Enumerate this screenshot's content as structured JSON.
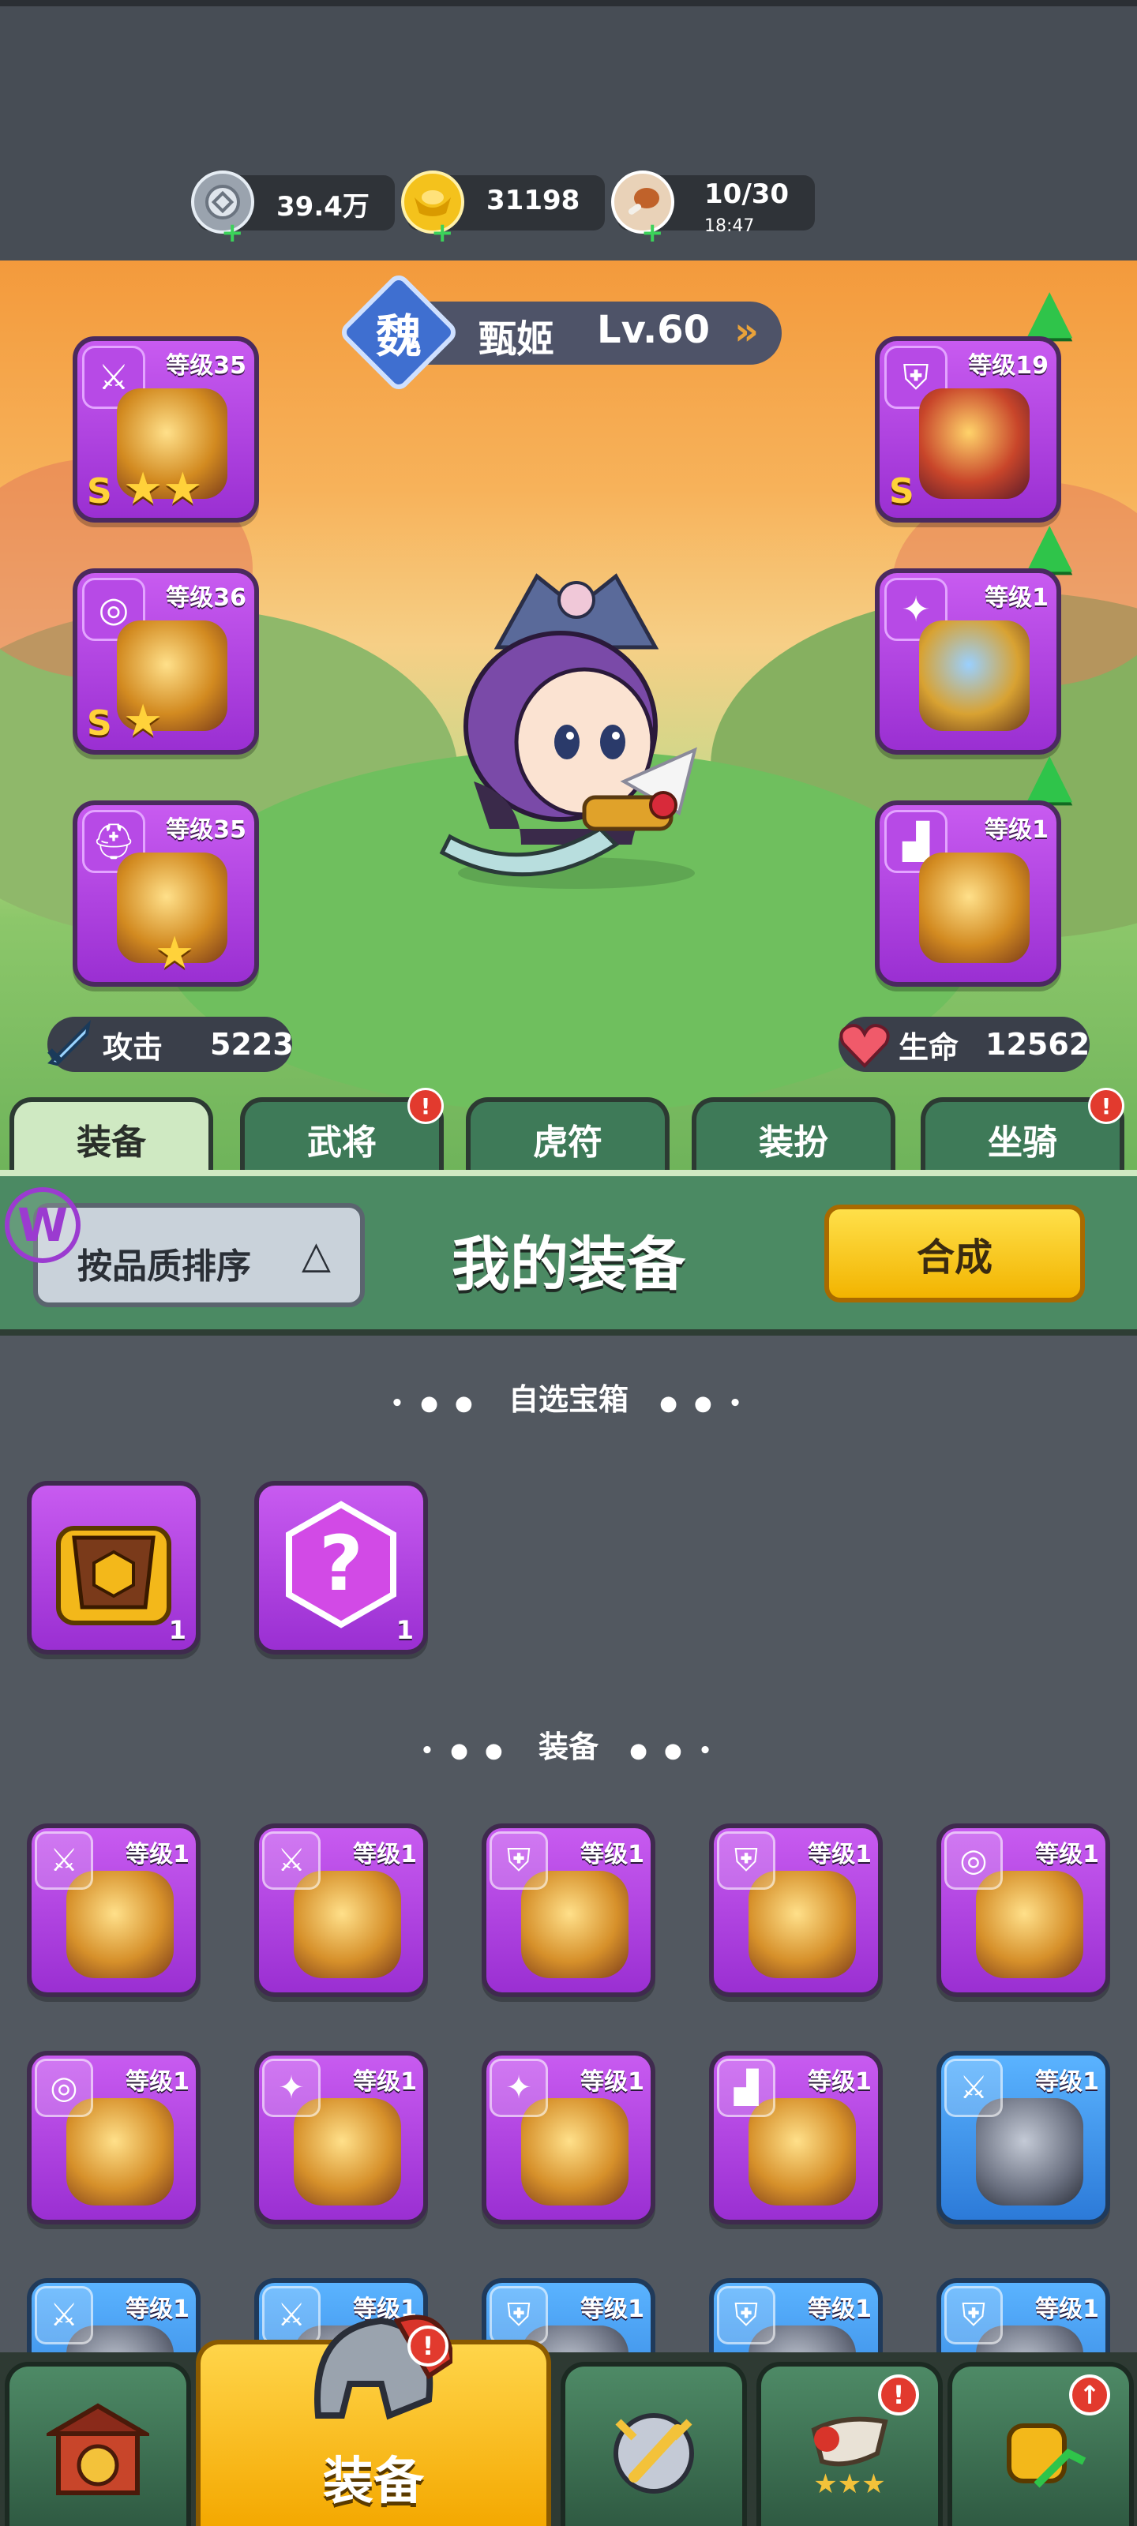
{
  "resources": [
    {
      "icon": "silver-coin-icon",
      "value": "39.4万",
      "sub": ""
    },
    {
      "icon": "gold-ingot-icon",
      "value": "31198",
      "sub": ""
    },
    {
      "icon": "meat-stamina-icon",
      "value": "10/30",
      "sub": "18:47"
    }
  ],
  "hero": {
    "faction": "魏",
    "name": "甄姬",
    "level": "Lv.60",
    "attack_label": "攻击",
    "attack_value": "5223",
    "hp_label": "生命",
    "hp_value": "12562"
  },
  "equip_slots": {
    "weapon": {
      "level": "等级35",
      "grade": "S",
      "stars": 2
    },
    "necklace": {
      "level": "等级36",
      "grade": "S",
      "stars": 1
    },
    "helmet": {
      "level": "等级35",
      "grade": "",
      "stars": 1
    },
    "armor": {
      "level": "等级19",
      "grade": "S",
      "stars": 0
    },
    "bracer": {
      "level": "等级1",
      "grade": "",
      "stars": 0
    },
    "boots": {
      "level": "等级1",
      "grade": "",
      "stars": 0
    }
  },
  "tabs": [
    {
      "label": "装备",
      "active": true,
      "alert": false
    },
    {
      "label": "武将",
      "active": false,
      "alert": true
    },
    {
      "label": "虎符",
      "active": false,
      "alert": false
    },
    {
      "label": "装扮",
      "active": false,
      "alert": false
    },
    {
      "label": "坐骑",
      "active": false,
      "alert": true
    }
  ],
  "panel": {
    "sort_label": "按品质排序",
    "title": "我的装备",
    "merge_label": "合成"
  },
  "chest_section": {
    "title": "自选宝箱",
    "items": [
      {
        "icon": "armor-chest-icon",
        "count": "1"
      },
      {
        "icon": "mystery-box-icon",
        "count": "1"
      }
    ]
  },
  "equip_section": {
    "title": "装备",
    "items": [
      {
        "type": "weapon",
        "level": "等级1",
        "color": "purple"
      },
      {
        "type": "weapon",
        "level": "等级1",
        "color": "purple"
      },
      {
        "type": "armor",
        "level": "等级1",
        "color": "purple"
      },
      {
        "type": "armor",
        "level": "等级1",
        "color": "purple"
      },
      {
        "type": "necklace",
        "level": "等级1",
        "color": "purple"
      },
      {
        "type": "necklace",
        "level": "等级1",
        "color": "purple"
      },
      {
        "type": "bracer",
        "level": "等级1",
        "color": "purple"
      },
      {
        "type": "bracer",
        "level": "等级1",
        "color": "purple"
      },
      {
        "type": "boots",
        "level": "等级1",
        "color": "purple"
      },
      {
        "type": "weapon",
        "level": "等级1",
        "color": "blue"
      },
      {
        "type": "weapon",
        "level": "等级1",
        "color": "blue"
      },
      {
        "type": "weapon",
        "level": "等级1",
        "color": "blue"
      },
      {
        "type": "armor",
        "level": "等级1",
        "color": "blue"
      },
      {
        "type": "armor",
        "level": "等级1",
        "color": "blue"
      },
      {
        "type": "armor",
        "level": "等级1",
        "color": "blue"
      }
    ]
  },
  "bottom_nav": {
    "active_label": "装备",
    "items": [
      "city-gate-icon",
      "helmet-icon",
      "sword-shield-icon",
      "war-horn-icon",
      "fist-upgrade-icon"
    ]
  },
  "colors": {
    "purple_card": "#b446e6",
    "blue_card": "#3f95ee",
    "panel_green": "#4b8a63",
    "merge_yellow": "#ffd21a",
    "alert_red": "#e23a2e"
  }
}
